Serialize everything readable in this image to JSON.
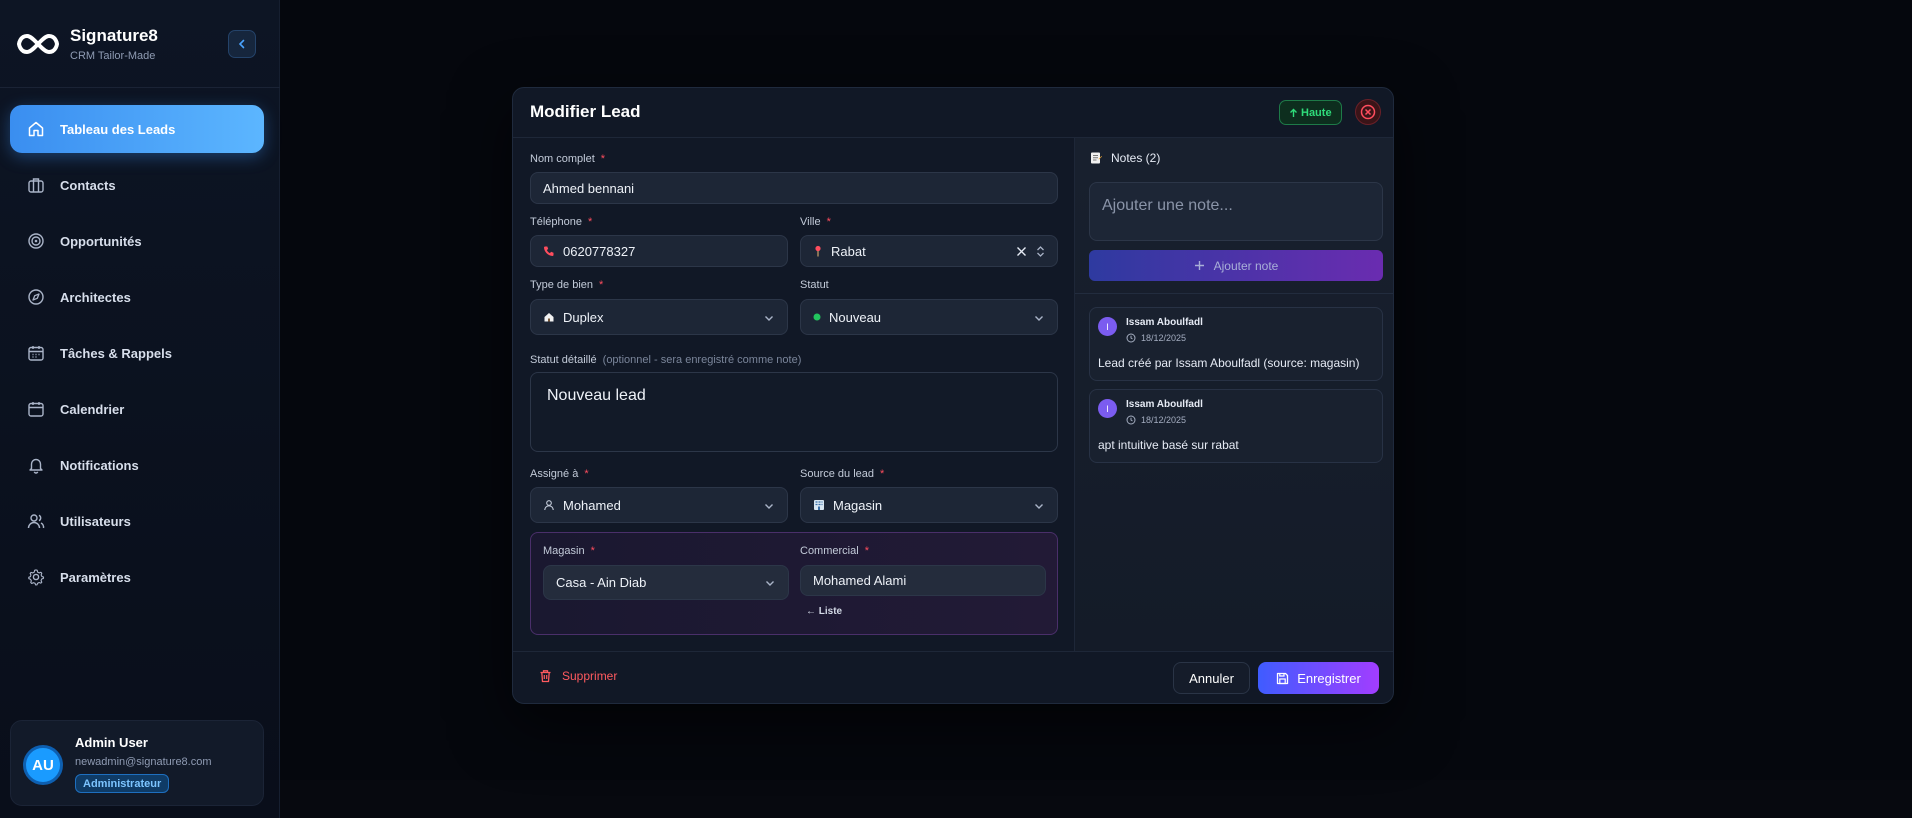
{
  "app": {
    "name": "Signature8",
    "subtitle": "CRM Tailor-Made"
  },
  "colors": {
    "accent": "#3a8ef0",
    "danger": "#ff4d5e",
    "success": "#2fdc7a",
    "save_gradient_start": "#3f5cff",
    "save_gradient_end": "#a23dff"
  },
  "sidebar": {
    "items": [
      {
        "label": "Tableau des Leads",
        "icon": "home-icon",
        "active": true
      },
      {
        "label": "Contacts",
        "icon": "briefcase-icon"
      },
      {
        "label": "Opportunités",
        "icon": "target-icon"
      },
      {
        "label": "Architectes",
        "icon": "compass-icon"
      },
      {
        "label": "Tâches & Rappels",
        "icon": "calendar-check-icon"
      },
      {
        "label": "Calendrier",
        "icon": "calendar-icon"
      },
      {
        "label": "Notifications",
        "icon": "bell-icon"
      },
      {
        "label": "Utilisateurs",
        "icon": "users-icon"
      },
      {
        "label": "Paramètres",
        "icon": "gear-icon"
      }
    ],
    "user": {
      "initials": "AU",
      "name": "Admin User",
      "email": "newadmin@signature8.com",
      "role": "Administrateur"
    }
  },
  "modal": {
    "title": "Modifier Lead",
    "priority": "Haute",
    "fields": {
      "full_name": {
        "label": "Nom complet",
        "value": "Ahmed bennani"
      },
      "phone": {
        "label": "Téléphone",
        "value": "0620778327"
      },
      "city": {
        "label": "Ville",
        "value": "Rabat"
      },
      "property_type": {
        "label": "Type de bien",
        "value": "Duplex"
      },
      "status": {
        "label": "Statut",
        "value": "Nouveau"
      },
      "detailed_status": {
        "label": "Statut détaillé",
        "hint": "(optionnel - sera enregistré comme note)",
        "value": "Nouveau lead"
      },
      "assigned_to": {
        "label": "Assigné à",
        "value": "Mohamed"
      },
      "lead_source": {
        "label": "Source du lead",
        "value": "Magasin"
      },
      "store": {
        "label": "Magasin",
        "value": "Casa - Ain Diab"
      },
      "salesperson": {
        "label": "Commercial",
        "value": "Mohamed Alami",
        "back_link": "← Liste"
      }
    },
    "required_marker": "*",
    "footer": {
      "delete": "Supprimer",
      "cancel": "Annuler",
      "save": "Enregistrer"
    },
    "notes": {
      "title": "Notes (2)",
      "placeholder": "Ajouter une note...",
      "add_button": "Ajouter note",
      "items": [
        {
          "avatar": "I",
          "author": "Issam Aboulfadl",
          "date": "18/12/2025",
          "text": "Lead créé par Issam Aboulfadl (source: magasin)"
        },
        {
          "avatar": "I",
          "author": "Issam Aboulfadl",
          "date": "18/12/2025",
          "text": "apt intuitive basé sur rabat"
        }
      ]
    }
  }
}
